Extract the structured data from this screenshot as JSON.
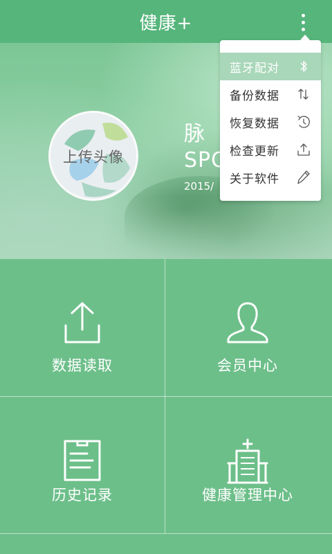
{
  "header": {
    "title": "健康+",
    "menu_icon": "more-vert-icon"
  },
  "hero": {
    "avatar_label": "上传头像",
    "title": "脉",
    "subtitle": "SPO",
    "date": "2015/"
  },
  "tiles": [
    {
      "label": "数据读取",
      "icon": "upload-icon"
    },
    {
      "label": "会员中心",
      "icon": "user-icon"
    },
    {
      "label": "历史记录",
      "icon": "notes-icon"
    },
    {
      "label": "健康管理中心",
      "icon": "hospital-icon"
    }
  ],
  "menu": {
    "items": [
      {
        "label": "蓝牙配对",
        "icon": "bluetooth-icon",
        "active": true
      },
      {
        "label": "备份数据",
        "icon": "backup-icon",
        "active": false
      },
      {
        "label": "恢复数据",
        "icon": "restore-icon",
        "active": false
      },
      {
        "label": "检查更新",
        "icon": "update-icon",
        "active": false
      },
      {
        "label": "关于软件",
        "icon": "pencil-icon",
        "active": false
      }
    ]
  },
  "colors": {
    "header": "#56b57b",
    "grid": "#6dbf8a",
    "menu_active": "#a9d7b9"
  }
}
